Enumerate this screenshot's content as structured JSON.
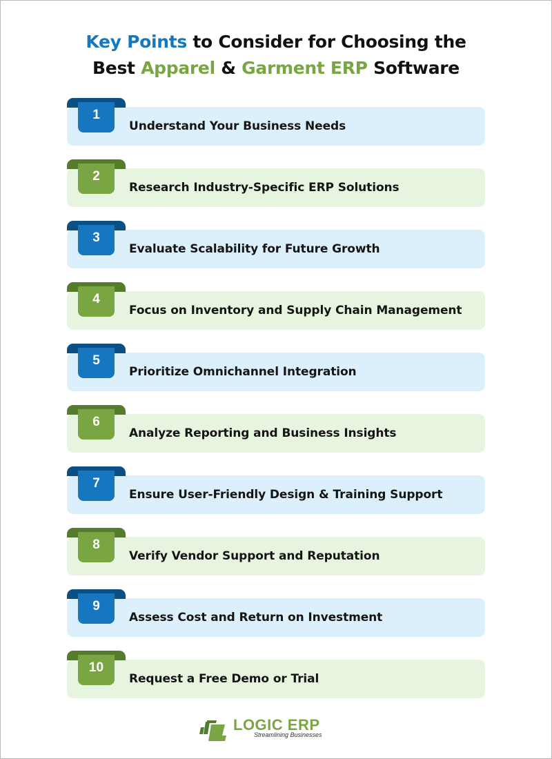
{
  "title": {
    "line1": {
      "highlight": "Key Points",
      "rest": " to Consider for Choosing the"
    },
    "line2": {
      "prefix": "Best ",
      "highlight1": "Apparel",
      "middle": " & ",
      "highlight2": "Garment ERP",
      "suffix": " Software"
    }
  },
  "colors": {
    "blue": "#1676bf",
    "blue_dark": "#0c4f84",
    "blue_light": "#dcf0fb",
    "green": "#79a543",
    "green_dark": "#557b2d",
    "green_light": "#e7f4df"
  },
  "items": [
    {
      "number": "1",
      "label": "Understand Your Business Needs",
      "theme": "blue"
    },
    {
      "number": "2",
      "label": "Research Industry-Specific ERP Solutions",
      "theme": "green"
    },
    {
      "number": "3",
      "label": "Evaluate Scalability for Future Growth",
      "theme": "blue"
    },
    {
      "number": "4",
      "label": "Focus on Inventory and Supply Chain Management",
      "theme": "green"
    },
    {
      "number": "5",
      "label": "Prioritize Omnichannel Integration",
      "theme": "blue"
    },
    {
      "number": "6",
      "label": "Analyze Reporting and Business Insights",
      "theme": "green"
    },
    {
      "number": "7",
      "label": "Ensure User-Friendly Design & Training Support",
      "theme": "blue"
    },
    {
      "number": "8",
      "label": "Verify Vendor Support and Reputation",
      "theme": "green"
    },
    {
      "number": "9",
      "label": "Assess Cost and Return on Investment",
      "theme": "blue"
    },
    {
      "number": "10",
      "label": "Request a Free Demo or Trial",
      "theme": "green"
    }
  ],
  "logo": {
    "icon": "logic-erp-logo-icon",
    "name": "LOGIC ERP",
    "tagline": "Streamlining Businesses"
  }
}
